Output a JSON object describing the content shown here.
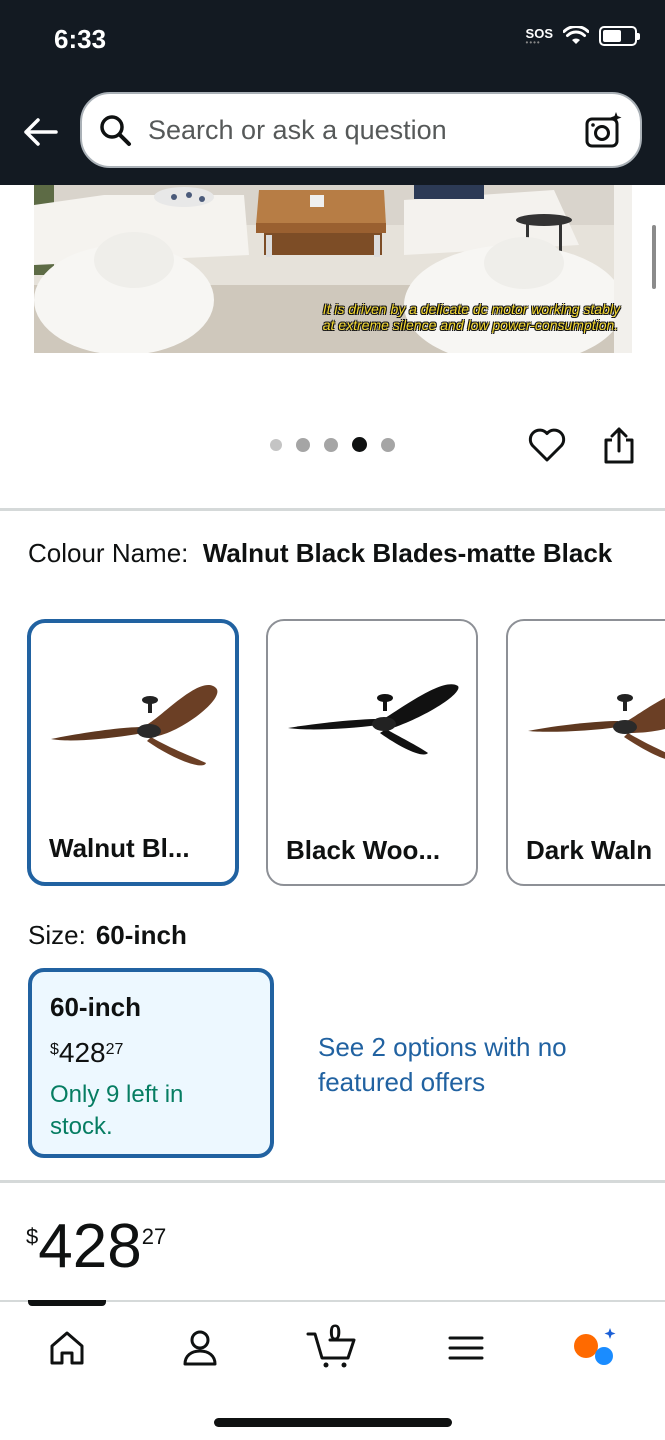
{
  "status_bar": {
    "time": "6:33",
    "sos": "SOS"
  },
  "search": {
    "placeholder": "Search or ask a question"
  },
  "image": {
    "caption_line1": "It is driven by a delicate dc motor working stably",
    "caption_line2": "at extreme silence and low power-consumption."
  },
  "carousel": {
    "total": 5,
    "active_index": 3
  },
  "colour": {
    "label": "Colour Name:",
    "value": "Walnut Black Blades-matte Black",
    "options": [
      {
        "label": "Walnut Bl...",
        "selected": true
      },
      {
        "label": "Black Woo...",
        "selected": false
      },
      {
        "label": "Dark Waln",
        "selected": false
      }
    ]
  },
  "size": {
    "label": "Size:",
    "value": "60-inch",
    "option": {
      "name": "60-inch",
      "currency": "$",
      "price_whole": "428",
      "price_cents": "27",
      "stock": "Only 9 left in stock."
    },
    "see_more": "See 2 options with no featured offers"
  },
  "price": {
    "currency": "$",
    "whole": "428",
    "cents": "27"
  },
  "bottom_nav": {
    "cart_count": "0",
    "items": [
      "home",
      "account",
      "cart",
      "menu",
      "rufus"
    ]
  },
  "colors": {
    "header_bg": "#131a22",
    "link": "#2162a1",
    "stock_green": "#067d62",
    "selected_border": "#2162a1"
  }
}
